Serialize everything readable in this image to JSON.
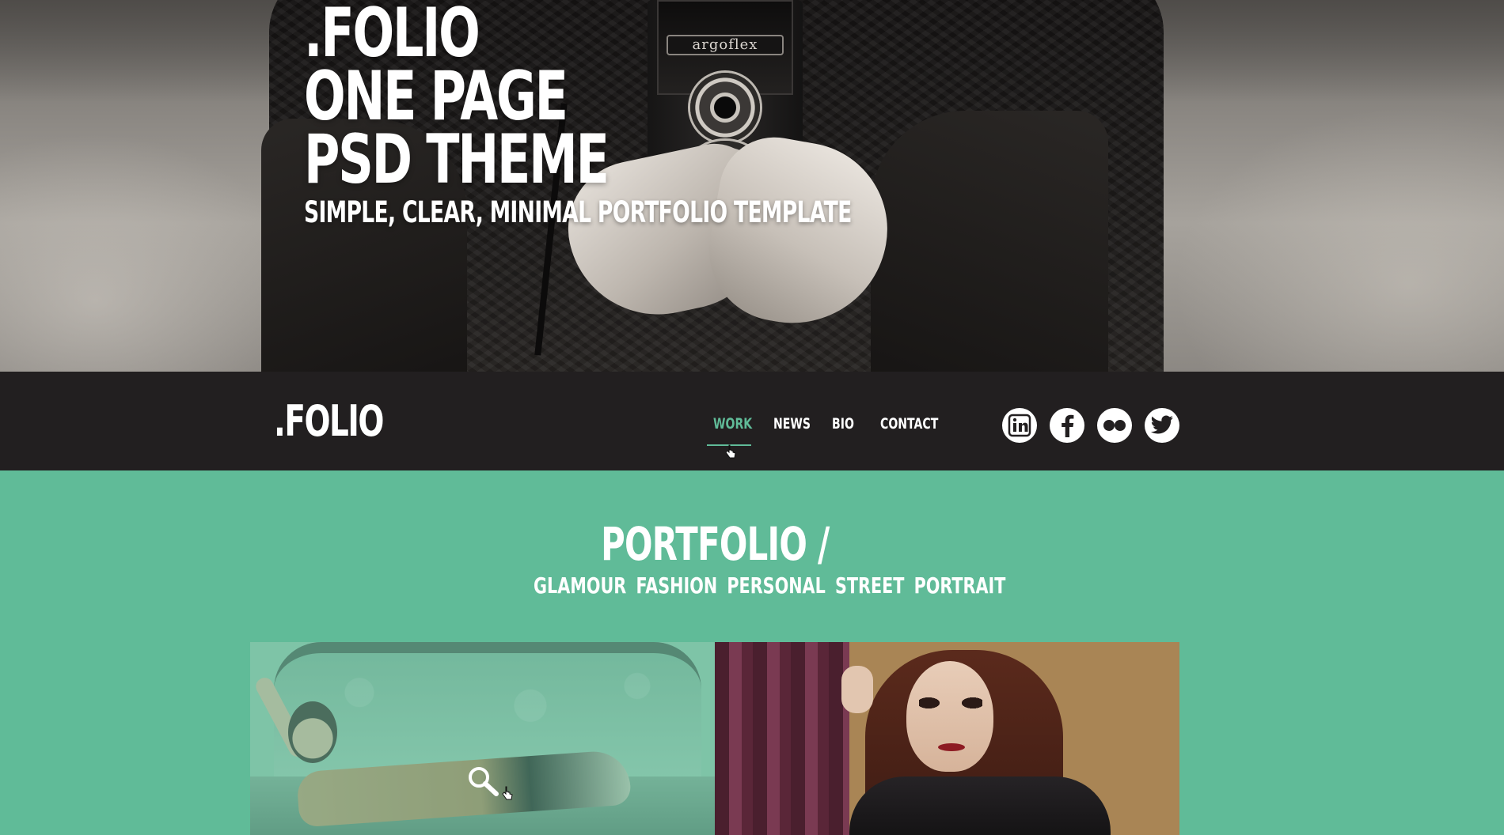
{
  "hero": {
    "title_lines": [
      ".FOLIO",
      "ONE PAGE",
      "PSD THEME"
    ],
    "subtitle": "SIMPLE, CLEAR, MINIMAL PORTFOLIO TEMPLATE",
    "camera_brand": "argoflex"
  },
  "nav": {
    "logo": ".FOLIO",
    "items": [
      {
        "label": "WORK",
        "active": true
      },
      {
        "label": "NEWS",
        "active": false
      },
      {
        "label": "BIO",
        "active": false
      },
      {
        "label": "CONTACT",
        "active": false
      }
    ],
    "social": [
      {
        "icon": "linkedin-icon",
        "label": "in"
      },
      {
        "icon": "facebook-icon",
        "label": "f"
      },
      {
        "icon": "flickr-icon",
        "label": ""
      },
      {
        "icon": "twitter-icon",
        "label": ""
      }
    ]
  },
  "portfolio": {
    "title": "PORTFOLIO /",
    "filters": [
      "GLAMOUR",
      "FASHION",
      "PERSONAL",
      "STREET",
      "PORTRAIT"
    ]
  },
  "colors": {
    "accent": "#60bb98",
    "nav_background": "#221f20",
    "text": "#ffffff"
  }
}
